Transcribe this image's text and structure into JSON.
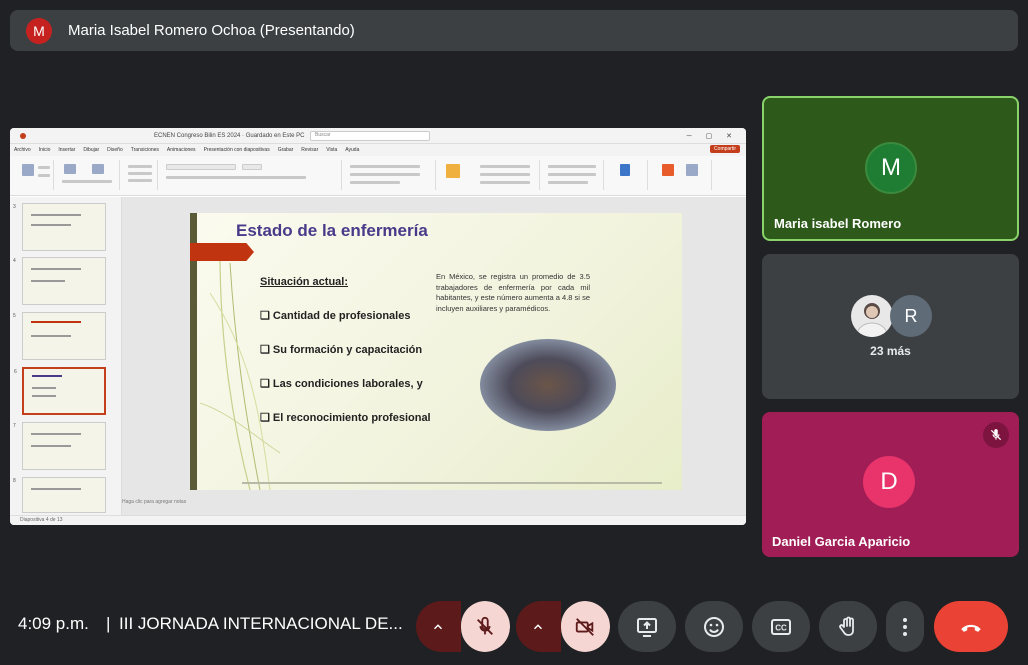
{
  "presenter": {
    "avatar_letter": "M",
    "title": "Maria Isabel Romero Ochoa (Presentando)"
  },
  "ppt": {
    "window_title": "ECNEN Congreso Bilin ES 2024 · Guardado en Este PC",
    "search_placeholder": "Buscar",
    "menu": [
      "Archivo",
      "Inicio",
      "Insertar",
      "Dibujar",
      "Diseño",
      "Transiciones",
      "Animaciones",
      "Presentación con diapositivas",
      "Grabar",
      "Revisar",
      "Vista",
      "Ayuda"
    ],
    "share_label": "Compartir",
    "notes_placeholder": "Haga clic para agregar notas",
    "status_text": "Diapositiva 4 de 13",
    "thumbs": [
      {
        "num": "3"
      },
      {
        "num": "4"
      },
      {
        "num": "5"
      },
      {
        "num": "6"
      },
      {
        "num": "7"
      },
      {
        "num": "8"
      }
    ]
  },
  "slide": {
    "title": "Estado de la enfermería",
    "subtitle": "Situación actual:",
    "bullets": [
      "❑ Cantidad de profesionales",
      "❑ Su formación y capacitación",
      "❑ Las condiciones laborales, y",
      "❑ El reconocimiento profesional"
    ],
    "paragraph": "En México, se registra un promedio de 3.5 trabajadores de enfermería por cada mil habitantes, y este número aumenta a 4.8 si se incluyen auxiliares y paramédicos."
  },
  "tiles": [
    {
      "letter": "M",
      "name": "Maria isabel Romero",
      "avatar_color": "#1e7d32"
    },
    {
      "mini_letter": "R",
      "more": "23 más"
    },
    {
      "letter": "D",
      "name": "Daniel Garcia Aparicio",
      "avatar_color": "#e8336b"
    }
  ],
  "bottom": {
    "time": "4:09 p.m.",
    "separator": "|",
    "meeting_title": "III JORNADA INTERNACIONAL DE..."
  },
  "controls": {
    "mic": "mic-off-icon",
    "camera": "camera-off-icon",
    "present": "present-screen-icon",
    "emoji": "emoji-icon",
    "captions": "captions-icon",
    "raise_hand": "raise-hand-icon",
    "more": "more-options-icon",
    "leave": "hang-up-icon",
    "captions_label": "CC"
  },
  "colors": {
    "background": "#202124",
    "hangup": "#ea4335",
    "speaking_border": "#8ad36b",
    "accent_ppt": "#c43e1c"
  }
}
